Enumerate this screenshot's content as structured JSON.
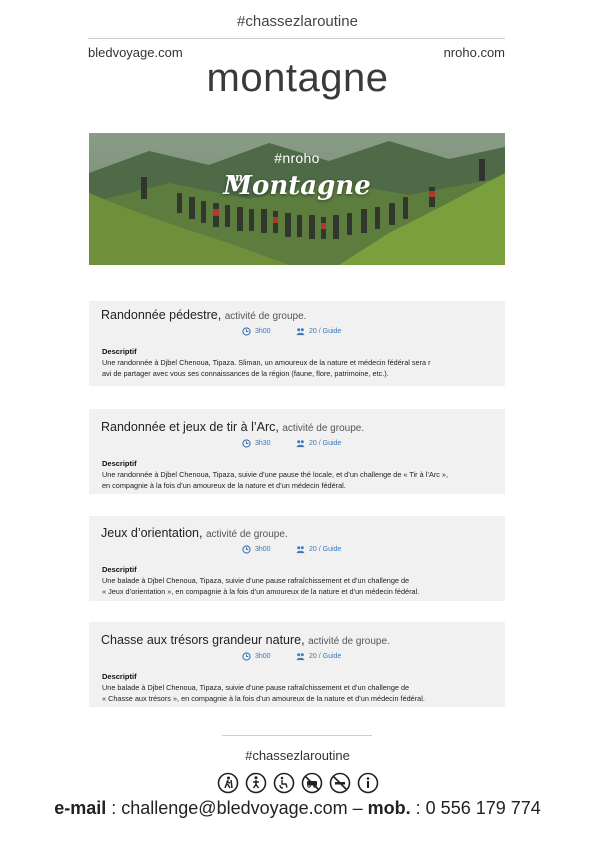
{
  "header": {
    "hashtag": "#chassezlaroutine",
    "site_left": "bledvoyage.com",
    "site_right": "nroho.com",
    "title": "montagne"
  },
  "banner": {
    "hashtag": "#nroho",
    "prefix": "en",
    "title": "Montagne"
  },
  "activities": [
    {
      "title": "Randonnée pédestre,",
      "subtitle": "activité de groupe.",
      "duration": "3h00",
      "capacity": "20 / Guide",
      "desc_label": "Descriptif",
      "desc_line1": "Une randonnée à Djbel Chenoua, Tipaza. Sliman, un amoureux de la nature et médecin fédéral sera r",
      "desc_line2": "avi de partager avec vous ses connaissances de la région (faune, flore, patrimoine, etc.)."
    },
    {
      "title": "Randonnée et jeux de tir à l’Arc,",
      "subtitle": "activité de groupe.",
      "duration": "3h30",
      "capacity": "20 / Guide",
      "desc_label": "Descriptif",
      "desc_line1": "Une randonnée à Djbel Chenoua, Tipaza, suivie d’une pause thé locale, et d’un challenge de « Tir à l’Arc »,",
      "desc_line2": "en compagnie à la fois d’un amoureux de la nature et d’un médecin fédéral."
    },
    {
      "title": "Jeux d’orientation,",
      "subtitle": "activité de groupe.",
      "duration": "3h00",
      "capacity": "20 / Guide",
      "desc_label": "Descriptif",
      "desc_line1": "Une balade à Djbel Chenoua, Tipaza, suivie d’une pause rafraîchissement et d’un challenge de",
      "desc_line2": "« Jeux d’orientation », en compagnie à la fois d’un amoureux de la nature et d’un médecin fédéral."
    },
    {
      "title": "Chasse aux trésors grandeur nature,",
      "subtitle": "activité de groupe.",
      "duration": "3h00",
      "capacity": "20 / Guide",
      "desc_label": "Descriptif",
      "desc_line1": "Une balade à Djbel Chenoua, Tipaza, suivie d’une pause rafraîchissement et d’un challenge de",
      "desc_line2": "« Chasse aux trésors », en compagnie à la fois d’un amoureux de la nature et d’un médecin fédéral."
    }
  ],
  "footer": {
    "hashtag": "#chassezlaroutine",
    "icons": [
      "hiking-icon",
      "walking-icon",
      "accessibility-icon",
      "no-vehicle-icon",
      "no-smoking-icon",
      "info-icon"
    ],
    "email_label": "e-mail",
    "email": " : challenge@bledvoyage.com – ",
    "phone_label": "mob.",
    "phone": " : 0 556 179 774"
  },
  "colors": {
    "accent": "#3a78b8",
    "card_bg": "#f1f1f1"
  }
}
